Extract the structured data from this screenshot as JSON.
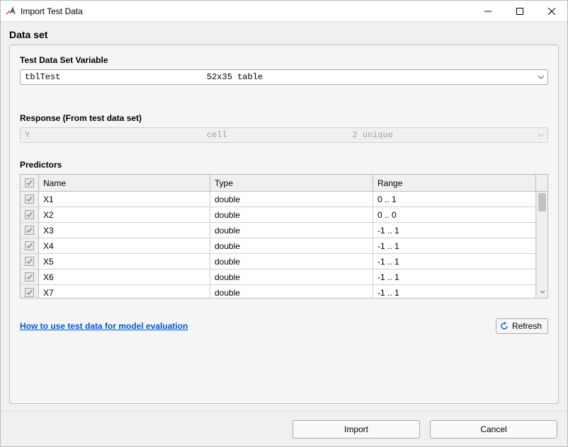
{
  "titlebar": {
    "title": "Import Test Data"
  },
  "section_title": "Data set",
  "labels": {
    "test_data_set_variable": "Test Data Set Variable",
    "response": "Response (From test data set)",
    "predictors": "Predictors"
  },
  "variable_dropdown": {
    "name": "tblTest",
    "dims": "52x35 table"
  },
  "response_dropdown": {
    "name": "Y",
    "type": "cell",
    "unique": "2 unique"
  },
  "table": {
    "headers": {
      "name": "Name",
      "type": "Type",
      "range": "Range"
    },
    "rows": [
      {
        "name": "X1",
        "type": "double",
        "range": "0 .. 1"
      },
      {
        "name": "X2",
        "type": "double",
        "range": "0 .. 0"
      },
      {
        "name": "X3",
        "type": "double",
        "range": "-1 .. 1"
      },
      {
        "name": "X4",
        "type": "double",
        "range": "-1 .. 1"
      },
      {
        "name": "X5",
        "type": "double",
        "range": "-1 .. 1"
      },
      {
        "name": "X6",
        "type": "double",
        "range": "-1 .. 1"
      },
      {
        "name": "X7",
        "type": "double",
        "range": "-1 .. 1"
      }
    ]
  },
  "help_link": "How to use test data for model evaluation",
  "buttons": {
    "refresh": "Refresh",
    "import": "Import",
    "cancel": "Cancel"
  }
}
